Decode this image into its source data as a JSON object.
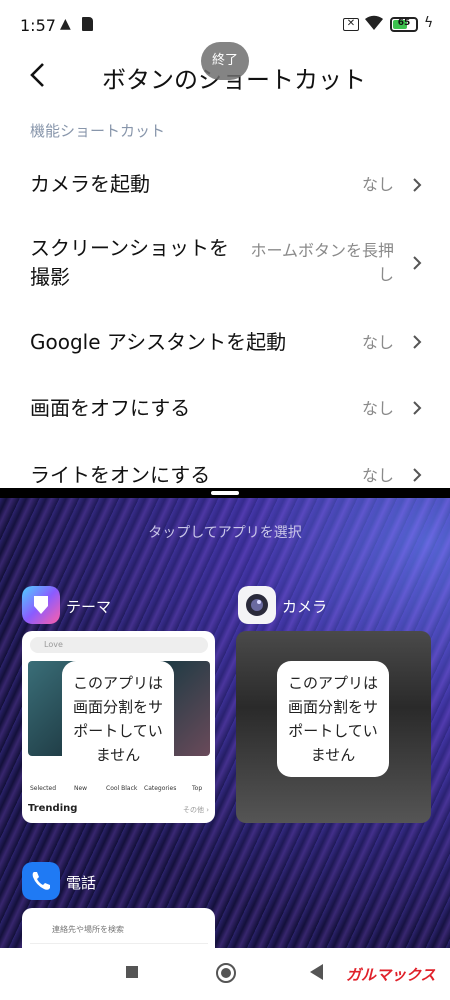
{
  "status_bar": {
    "time": "1:57",
    "warning_icon": "warning-icon",
    "battery_level": "65"
  },
  "header": {
    "title": "ボタンのショートカット",
    "end_pill": "終了"
  },
  "section_title": "機能ショートカット",
  "shortcuts": [
    {
      "label": "カメラを起動",
      "value": "なし"
    },
    {
      "label_line1": "スクリーンショットを",
      "label_line2": "撮影",
      "value_line1": "ホームボタンを長押",
      "value_line2": "し"
    },
    {
      "label": "Google アシスタントを起動",
      "value": "なし"
    },
    {
      "label": "画面をオフにする",
      "value": "なし"
    },
    {
      "label": "ライトをオンにする",
      "value": "なし"
    }
  ],
  "recents": {
    "hint": "タップしてアプリを選択",
    "apps": [
      {
        "name": "テーマ",
        "search_placeholder": "Love",
        "tabs": [
          "Selected",
          "New",
          "Cool Black",
          "Categories",
          "Top"
        ],
        "trending": "Trending",
        "more": "その他 ›"
      },
      {
        "name": "カメラ"
      },
      {
        "name": "電話",
        "search_placeholder": "連絡先や場所を検索"
      }
    ],
    "no_split_message": "このアプリは画面分割をサポートしていません"
  },
  "watermark": "ガルマックス",
  "colors": {
    "accent_green": "#3cc24e",
    "secondary_text": "#8a8a8a",
    "section_text": "#8896ab",
    "watermark": "#e0212a"
  }
}
